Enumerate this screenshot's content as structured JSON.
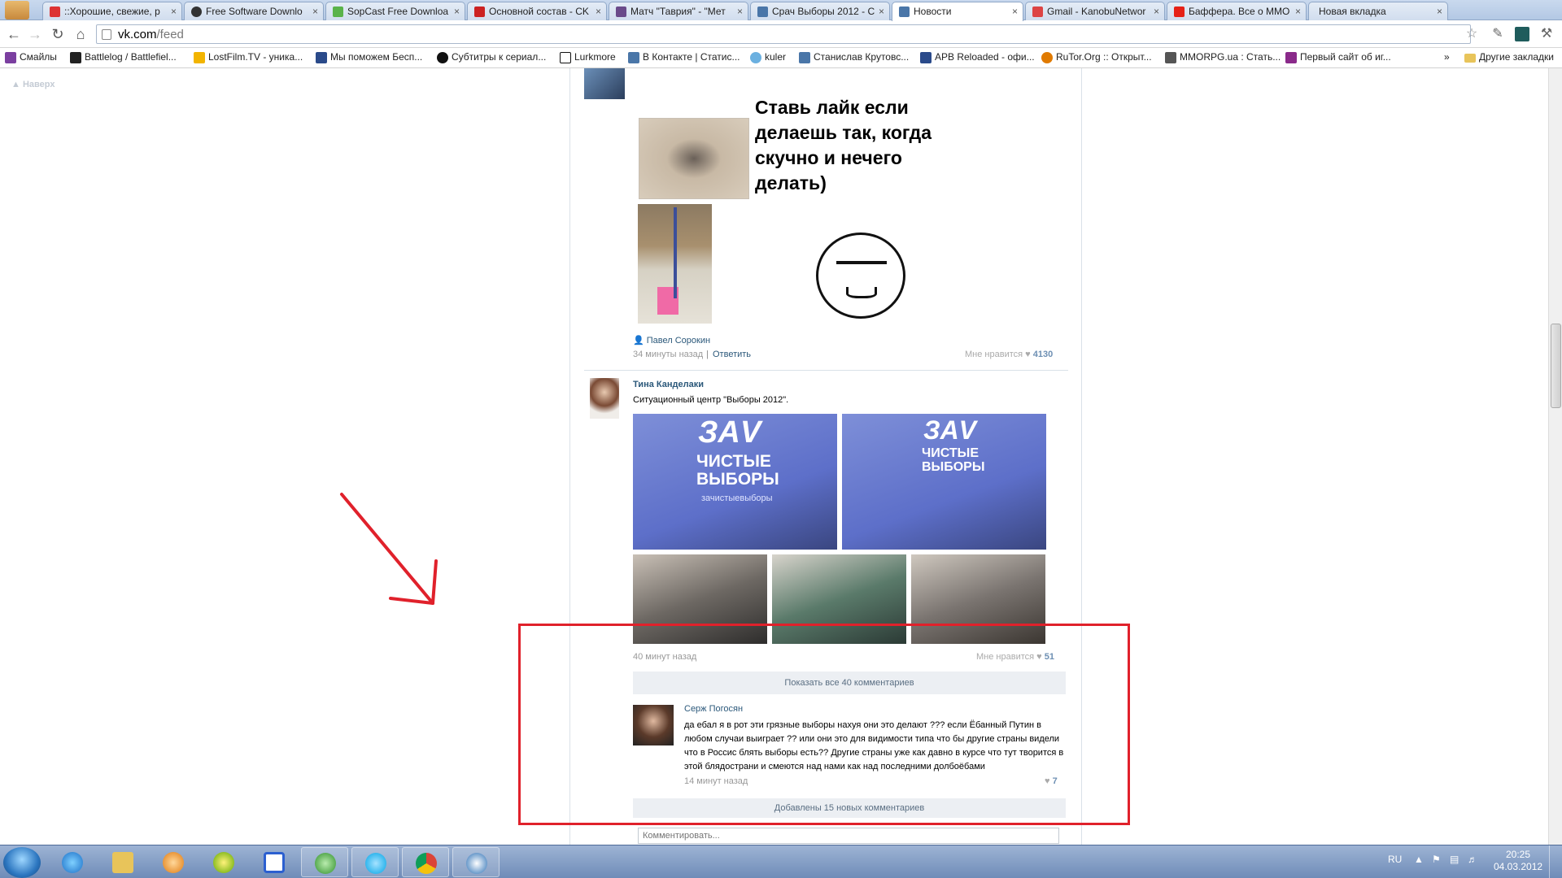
{
  "browser": {
    "tabs": [
      {
        "title": "::Хорошие, свежие, р",
        "active": false
      },
      {
        "title": "Free Software Downlo",
        "active": false
      },
      {
        "title": "SopCast Free Downloa",
        "active": false
      },
      {
        "title": "Основной состав - CK",
        "active": false
      },
      {
        "title": "Матч \"Таврия\" - \"Мет",
        "active": false
      },
      {
        "title": "Срач Выборы 2012 - С",
        "active": false
      },
      {
        "title": "Новости",
        "active": true
      },
      {
        "title": "Gmail - KanobuNetwor",
        "active": false
      },
      {
        "title": "Баффера. Все о ММО",
        "active": false
      },
      {
        "title": "Новая вкладка",
        "active": false
      }
    ],
    "close_glyph": "×",
    "url_host": "vk.com",
    "url_path": "/feed",
    "bookmarks": [
      "Смайлы",
      "Battlelog / Battlefiel...",
      "LostFilm.TV - уника...",
      "Мы поможем Бесп...",
      "Субтитры к сериал...",
      "Lurkmore",
      "В Контакте | Статис...",
      "kuler",
      "Станислав Крутовс...",
      "APB Reloaded - офи...",
      "RuTor.Org :: Открыт...",
      "MMORPG.ua : Стать...",
      "Первый сайт об иг..."
    ],
    "bookmarks_overflow": "»",
    "other_bookmarks": "Другие закладки"
  },
  "page": {
    "scroll_top": "Наверх",
    "post1": {
      "meme_text": "Ставь лайк если делаешь так, когда скучно и нечего делать)",
      "shared_by": "Павел Сорокин",
      "time": "34 минуты назад",
      "separator": "|",
      "reply": "Ответить",
      "like_label": "Мне нравится",
      "like_count": "4130"
    },
    "post2": {
      "author": "Тина Канделаки",
      "text": "Ситуационный центр \"Выборы 2012\".",
      "photo_big_text": "ЗАV",
      "photo_sub_text": "ЧИСТЫЕ ВЫБОРЫ",
      "photo_small_text": "зачистыевыборы",
      "time": "40 минут назад",
      "like_label": "Мне нравится",
      "like_count": "51",
      "show_all_comments": "Показать все 40 комментариев",
      "comment": {
        "author": "Серж Погосян",
        "text": "да ебал я в рот эти грязные выборы нахуя они это делают ??? если Ёбанный Путин в любом случаи выиграет ?? или они это для видимости типа что бы другие страны видели что в Россис блять выборы есть?? Другие страны уже как давно в курсе что тут творится в этой блядострани и смеются над нами как над последними долбоёбами",
        "time": "14 минут назад",
        "like_count": "7"
      },
      "new_comments": "Добавлены 15 новых комментариев",
      "comment_placeholder": "Комментировать..."
    }
  },
  "taskbar": {
    "lang": "RU",
    "time": "20:25",
    "date": "04.03.2012"
  },
  "colors": {
    "link": "#2b587a",
    "annotation": "#e0212b"
  }
}
